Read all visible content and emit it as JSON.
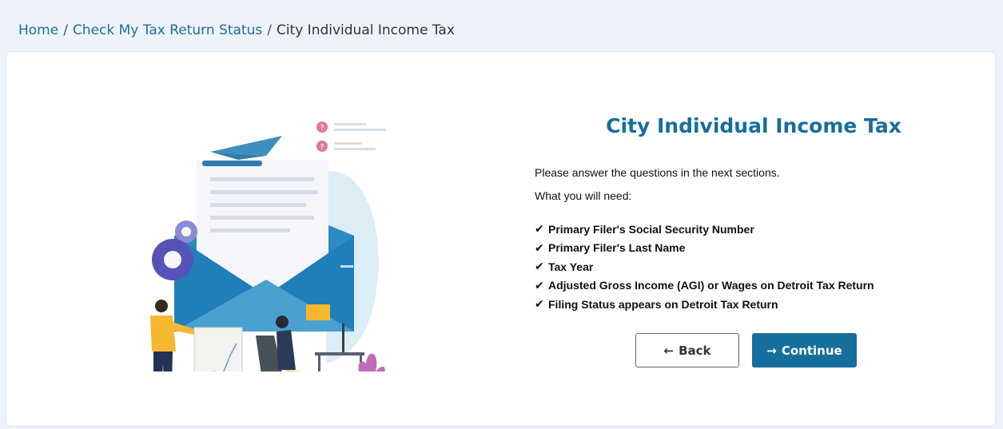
{
  "breadcrumb": {
    "home": "Home",
    "check_status": "Check My Tax Return Status",
    "current": "City Individual Income Tax",
    "separator": "/"
  },
  "main": {
    "title": "City Individual Income Tax",
    "intro": "Please answer the questions in the next sections.",
    "need_label": "What you will need:",
    "check_glyph": "✔",
    "items": [
      "Primary Filer's Social Security Number",
      "Primary Filer's Last Name",
      "Tax Year",
      "Adjusted Gross Income (AGI) or Wages on Detroit Tax Return",
      "Filing Status appears on Detroit Tax Return"
    ]
  },
  "buttons": {
    "back_arrow": "←",
    "back": "Back",
    "continue_arrow": "→",
    "continue": "Continue"
  },
  "colors": {
    "accent": "#166e9d",
    "page_bg": "#eef3f9"
  }
}
